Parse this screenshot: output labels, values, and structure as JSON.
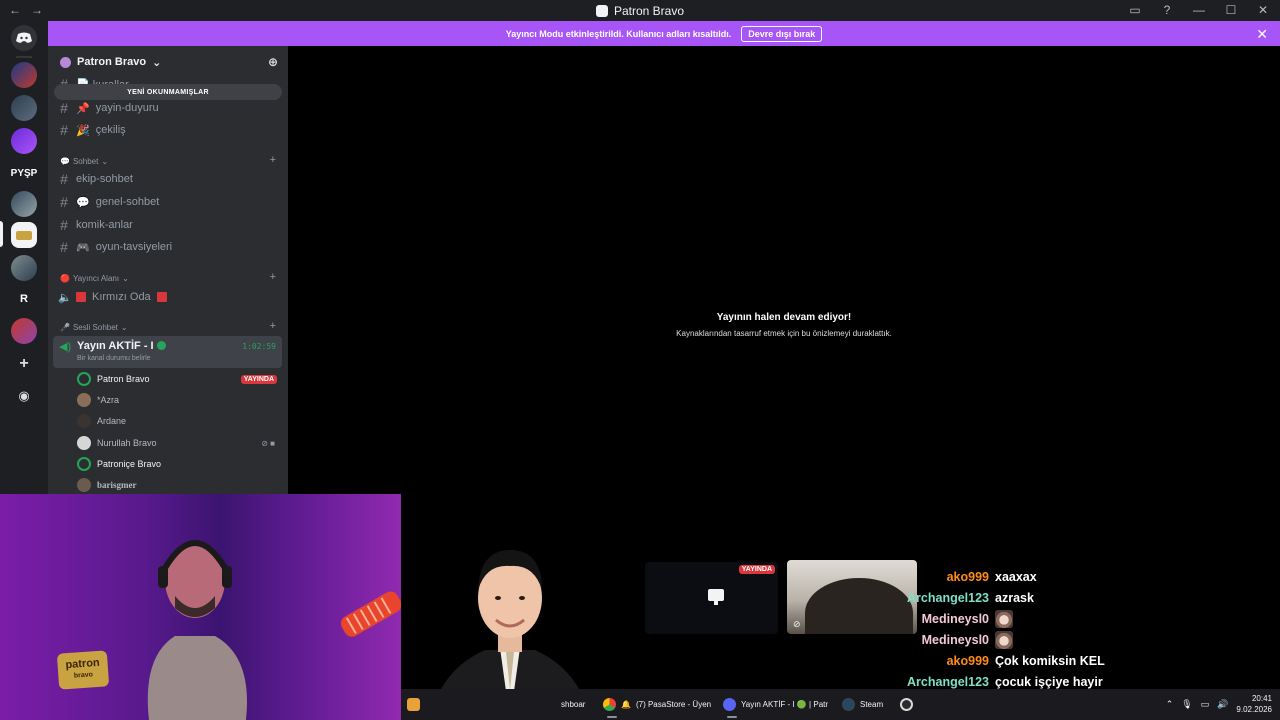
{
  "window": {
    "title": "Patron Bravo",
    "nav_back": "←",
    "nav_forward": "→",
    "btn_inbox": "▭",
    "btn_help": "?",
    "btn_minimize": "—",
    "btn_maximize": "☐",
    "btn_close": "✕"
  },
  "rail": {
    "pysp_label": "PYŞP",
    "r_label": "R",
    "add_label": "+",
    "explore_label": "◉"
  },
  "banner": {
    "text": "Yayıncı Modu etkinleştirildi. Kullanıcı adları kısaltıldı.",
    "button": "Devre dışı bırak",
    "close": "✕"
  },
  "sidebar": {
    "guild_name": "Patron Bravo",
    "guild_chevron": "⌄",
    "unread_pill": "YENİ OKUNMAMIŞLAR",
    "partial_channel": "📄 kurallar",
    "channels_top": [
      {
        "icon": "📌",
        "name": "yayin-duyuru"
      },
      {
        "icon": "🎉",
        "name": "çekiliş"
      }
    ],
    "cat_sohbet": {
      "emoji": "💬",
      "name": "Sohbet"
    },
    "channels_sohbet": [
      {
        "icon": "",
        "name": "ekip-sohbet"
      },
      {
        "icon": "💬",
        "name": "genel-sohbet"
      },
      {
        "icon": "",
        "name": "komik-anlar"
      },
      {
        "icon": "🎮",
        "name": "oyun-tavsiyeleri"
      }
    ],
    "cat_yayinci": {
      "emoji": "🔴",
      "name": "Yayıncı Alanı"
    },
    "red_room": "Kırmızı Oda",
    "cat_sesli": {
      "emoji": "🎤",
      "name": "Sesli Sohbet"
    },
    "active_voice": {
      "name": "Yayın AKTİF - I",
      "timer": "1:02:59",
      "status": "Bir kanal durumu belirle"
    },
    "members": [
      {
        "name": "Patron Bravo",
        "badge": "YAYINDA"
      },
      {
        "name": "*Azra",
        "badge": ""
      },
      {
        "name": "Ardane",
        "badge": ""
      },
      {
        "name": "Nurullah Bravo",
        "badge": ""
      },
      {
        "name": "Patroniçe Bravo",
        "badge": ""
      },
      {
        "name": "barisgmer",
        "badge": ""
      }
    ],
    "colors": {
      "accent_purple": "#a855f7",
      "live_red": "#da373c",
      "online_green": "#23a55a"
    }
  },
  "stream": {
    "title": "Yayının halen devam ediyor!",
    "subtitle": "Kaynaklarından tasarruf etmek için bu önizlemeyi duraklattık.",
    "tile_badge": "YAYINDA"
  },
  "webcam": {
    "logo_top": "patron",
    "logo_bottom": "bravo"
  },
  "chat": {
    "lines": [
      {
        "user": "ako999",
        "msg": "xaaxax",
        "color": "#ff8c1a",
        "emote": false
      },
      {
        "user": "Archangel123",
        "msg": "azrask",
        "color": "#7fe0c8",
        "emote": false
      },
      {
        "user": "Medineysl0",
        "msg": "",
        "color": "#f4c9d6",
        "emote": true
      },
      {
        "user": "Medineysl0",
        "msg": "",
        "color": "#f4c9d6",
        "emote": true
      },
      {
        "user": "ako999",
        "msg": "Çok komiksin KEL",
        "color": "#ff8c1a",
        "emote": false
      },
      {
        "user": "Archangel123",
        "msg": "çocuk işçiye hayir",
        "color": "#7fe0c8",
        "emote": false
      },
      {
        "user": "Medineysl0",
        "msg": "",
        "color": "#f4c9d6",
        "emote": true
      }
    ]
  },
  "taskbar": {
    "tasks": [
      {
        "label": "shboar",
        "icon_color": "#4a4a50"
      },
      {
        "label": "(7) PasaStore - Üyen",
        "icon_color": "#f4b400"
      },
      {
        "label": "Yayın AKTİF - I 🟢 | Patr",
        "icon_color": "#5865f2"
      },
      {
        "label": "Steam",
        "icon_color": "#1b2838"
      },
      {
        "label": "",
        "icon_color": "#2b2b2b"
      }
    ],
    "tray_chevron": "⌃",
    "time": "20:41",
    "date": "9.02.2026"
  }
}
